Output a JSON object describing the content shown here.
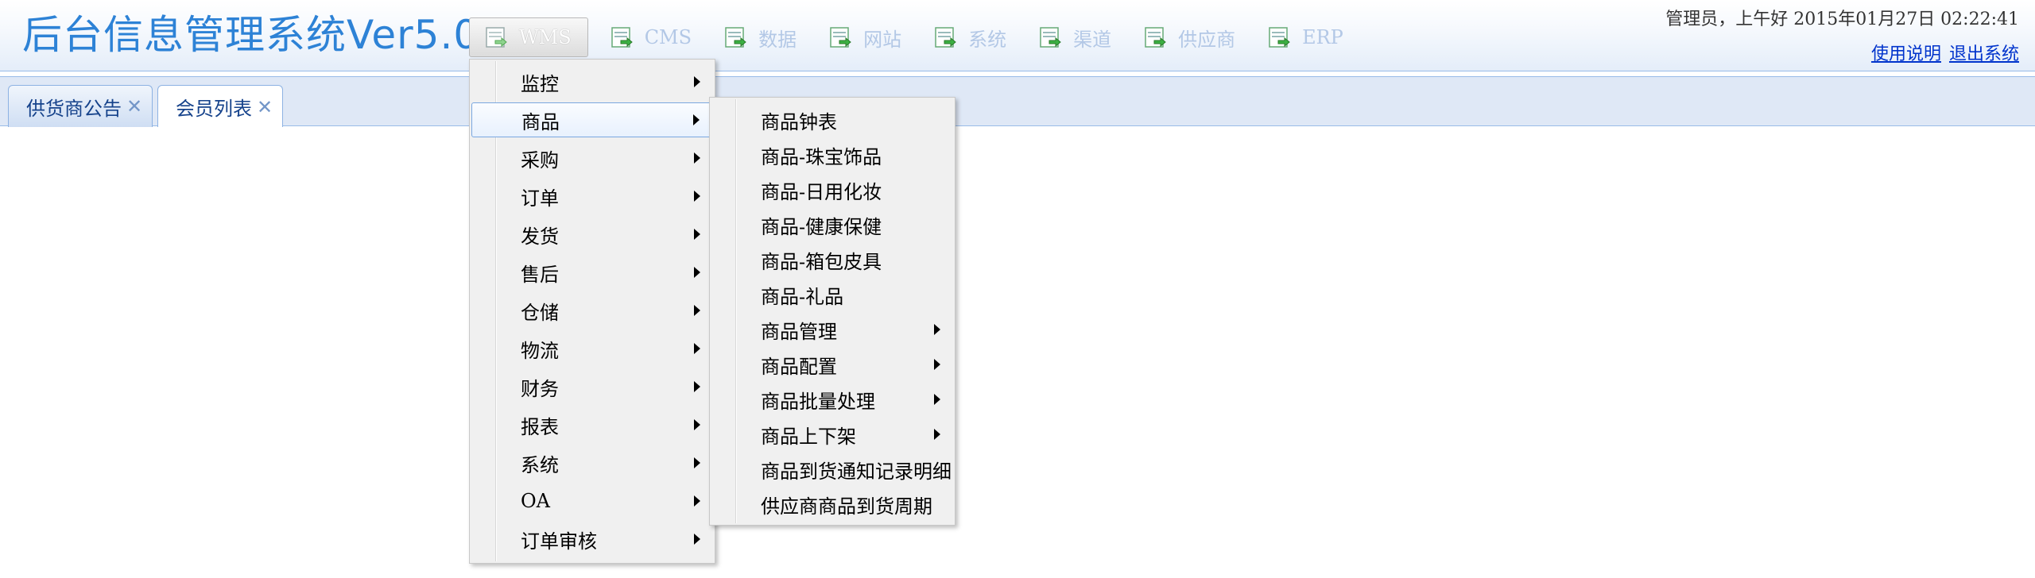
{
  "app": {
    "title": "后台信息管理系统Ver5.0"
  },
  "topnav": [
    {
      "label": "WMS",
      "icon": "module-icon",
      "active": true
    },
    {
      "label": "CMS",
      "icon": "module-icon"
    },
    {
      "label": "数据",
      "icon": "module-icon"
    },
    {
      "label": "网站",
      "icon": "module-icon"
    },
    {
      "label": "系统",
      "icon": "module-icon"
    },
    {
      "label": "渠道",
      "icon": "module-icon"
    },
    {
      "label": "供应商",
      "icon": "module-icon"
    },
    {
      "label": "ERP",
      "icon": "module-icon"
    }
  ],
  "user": {
    "greeting": "管理员，上午好 2015年01月27日 02:22:41",
    "help_link": "使用说明",
    "logout_link": "退出系统"
  },
  "tabs": [
    {
      "label": "供货商公告",
      "close": "✕"
    },
    {
      "label": "会员列表",
      "close": "✕",
      "active": true
    }
  ],
  "main_menu": [
    {
      "label": "监控"
    },
    {
      "label": "商品",
      "highlighted": true
    },
    {
      "label": "采购"
    },
    {
      "label": "订单"
    },
    {
      "label": "发货"
    },
    {
      "label": "售后"
    },
    {
      "label": "仓储"
    },
    {
      "label": "物流"
    },
    {
      "label": "财务"
    },
    {
      "label": "报表"
    },
    {
      "label": "系统"
    },
    {
      "label": "OA"
    },
    {
      "label": "订单审核"
    }
  ],
  "sub_menu": [
    {
      "label": "商品钟表",
      "has_submenu": false
    },
    {
      "label": "商品-珠宝饰品",
      "has_submenu": false
    },
    {
      "label": "商品-日用化妆",
      "has_submenu": false
    },
    {
      "label": "商品-健康保健",
      "has_submenu": false
    },
    {
      "label": "商品-箱包皮具",
      "has_submenu": false
    },
    {
      "label": "商品-礼品",
      "has_submenu": false
    },
    {
      "label": "商品管理",
      "has_submenu": true
    },
    {
      "label": "商品配置",
      "has_submenu": true
    },
    {
      "label": "商品批量处理",
      "has_submenu": true
    },
    {
      "label": "商品上下架",
      "has_submenu": true
    },
    {
      "label": "商品到货通知记录明细",
      "has_submenu": false
    },
    {
      "label": "供应商商品到货周期",
      "has_submenu": false
    }
  ],
  "colors": {
    "title": "#2d82d6",
    "tabbar": "#dfe8f6",
    "tab_text": "#15428b",
    "link": "#0033cc",
    "menu_bg": "#f0f0f0"
  }
}
